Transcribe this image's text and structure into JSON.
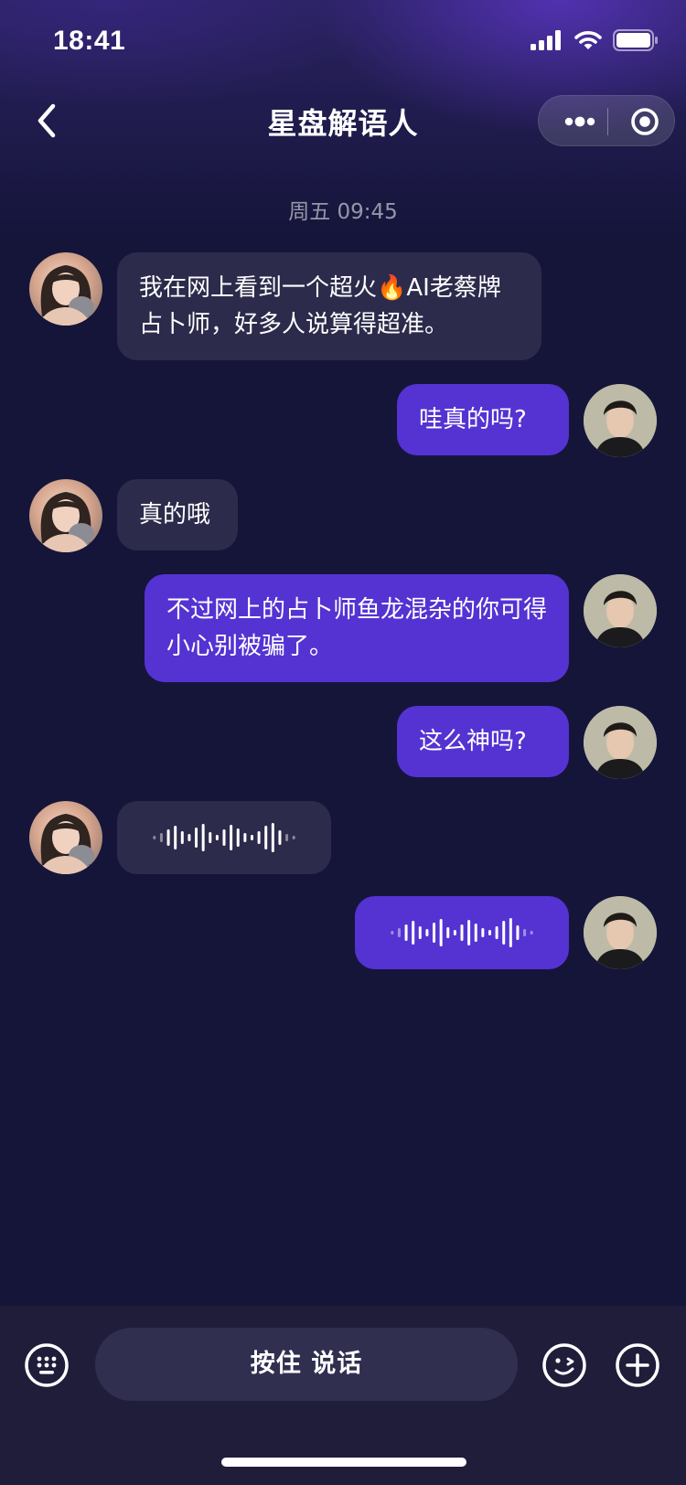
{
  "status_bar": {
    "time": "18:41"
  },
  "nav": {
    "title": "星盘解语人"
  },
  "chat": {
    "timestamp": "周五 09:45",
    "messages": [
      {
        "side": "left",
        "type": "text",
        "text": "我在网上看到一个超火🔥AI老蔡牌占卜师，好多人说算得超准。"
      },
      {
        "side": "right",
        "type": "text",
        "text": "哇真的吗?"
      },
      {
        "side": "left",
        "type": "text",
        "text": "真的哦"
      },
      {
        "side": "right",
        "type": "text",
        "text": "不过网上的占卜师鱼龙混杂的你可得小心别被骗了。"
      },
      {
        "side": "right",
        "type": "text",
        "text": "这么神吗?"
      },
      {
        "side": "left",
        "type": "voice"
      },
      {
        "side": "right",
        "type": "voice"
      }
    ]
  },
  "input_bar": {
    "hold_to_talk": "按住 说话"
  },
  "colors": {
    "background": "#15153a",
    "incoming_bubble": "#2c2b4b",
    "outgoing_bubble": "#5433d2",
    "input_bar": "#1f1d3a"
  },
  "icons": [
    "back-icon",
    "more-icon",
    "close-icon",
    "keyboard-icon",
    "emoji-icon",
    "plus-icon",
    "voice-wave-icon",
    "signal-icon",
    "wifi-icon",
    "battery-icon"
  ]
}
